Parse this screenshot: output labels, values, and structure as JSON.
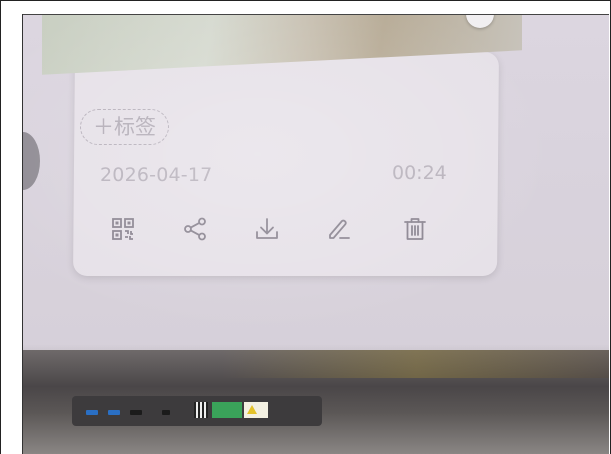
{
  "card": {
    "tag_button_label": "＋标签",
    "date": "2026-04-17",
    "duration": "00:24"
  },
  "actions": [
    {
      "name": "qr-code-icon"
    },
    {
      "name": "share-icon"
    },
    {
      "name": "download-icon"
    },
    {
      "name": "edit-icon"
    },
    {
      "name": "delete-icon"
    }
  ],
  "colors": {
    "screen_bg": "#dcd6e0",
    "card_bg": "#e6e1e8",
    "text_muted": "#b7b1bb",
    "icon_color": "#8a8490",
    "bezel": "#4a4648"
  }
}
